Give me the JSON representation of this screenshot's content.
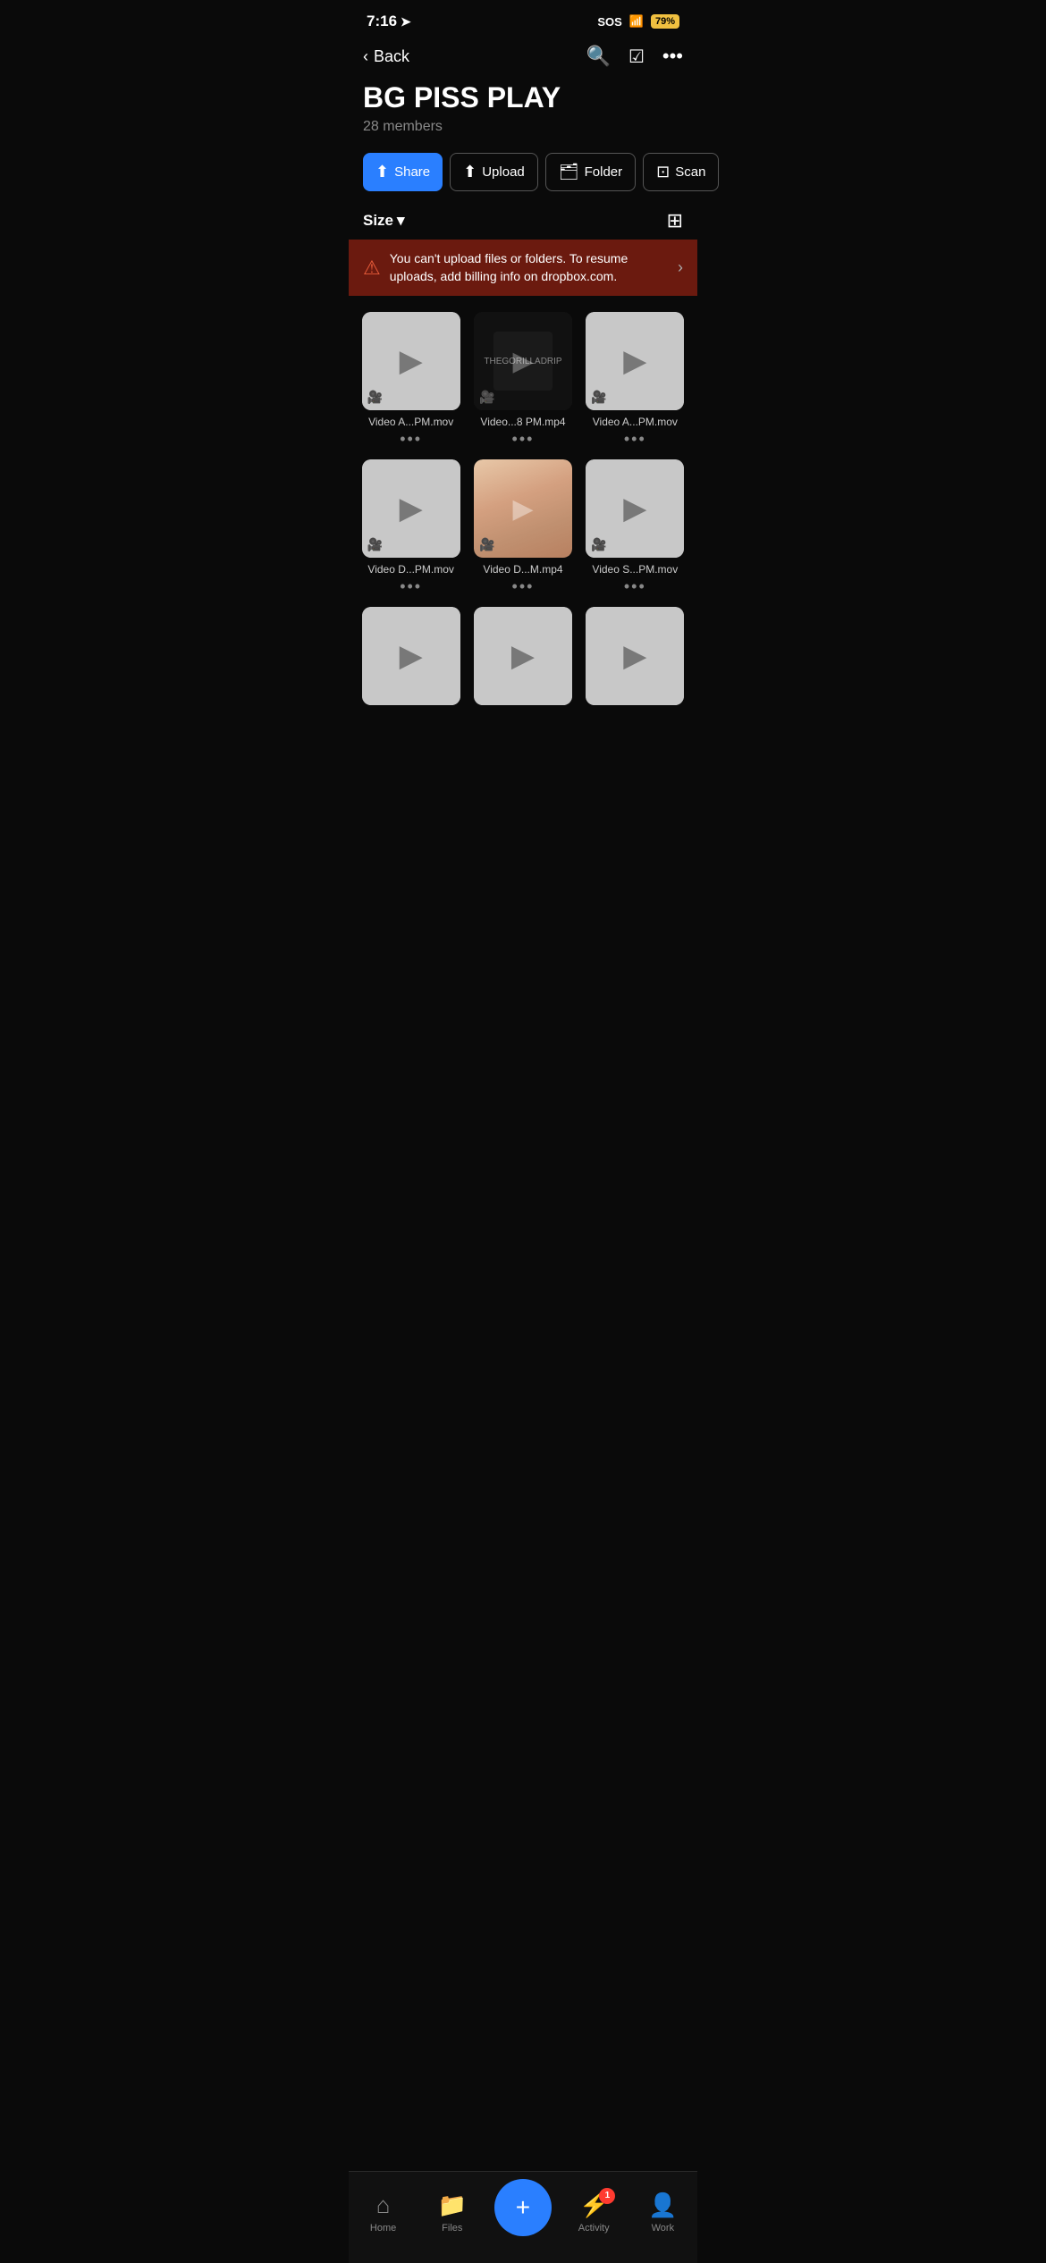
{
  "statusBar": {
    "time": "7:16",
    "sos": "SOS",
    "battery": "79",
    "batteryUnit": "%"
  },
  "header": {
    "backLabel": "Back",
    "searchIcon": "search",
    "checkIcon": "check-square",
    "moreIcon": "ellipsis"
  },
  "folder": {
    "title": "BG PISS PLAY",
    "members": "28 members"
  },
  "actionButtons": [
    {
      "id": "share",
      "icon": "↑",
      "label": "Share",
      "style": "primary"
    },
    {
      "id": "upload",
      "icon": "⬆",
      "label": "Upload",
      "style": "secondary"
    },
    {
      "id": "folder",
      "icon": "📁",
      "label": "Folder",
      "style": "secondary"
    },
    {
      "id": "scan",
      "icon": "⊡",
      "label": "Scan",
      "style": "secondary"
    }
  ],
  "sort": {
    "label": "Size",
    "chevron": "▾"
  },
  "warning": {
    "text": "You can't upload files or folders. To resume uploads, add billing info on dropbox.com."
  },
  "files": [
    {
      "id": 1,
      "name": "Video A...PM.mov",
      "type": "video",
      "preview": "dark"
    },
    {
      "id": 2,
      "name": "Video...8 PM.mp4",
      "type": "video",
      "preview": "dark-preview"
    },
    {
      "id": 3,
      "name": "Video A...PM.mov",
      "type": "video",
      "preview": "dark"
    },
    {
      "id": 4,
      "name": "Video D...PM.mov",
      "type": "video",
      "preview": "dark"
    },
    {
      "id": 5,
      "name": "Video D...M.mp4",
      "type": "video",
      "preview": "skin"
    },
    {
      "id": 6,
      "name": "Video S...PM.mov",
      "type": "video",
      "preview": "dark"
    },
    {
      "id": 7,
      "name": "",
      "type": "video",
      "preview": "dark"
    },
    {
      "id": 8,
      "name": "",
      "type": "video",
      "preview": "dark"
    },
    {
      "id": 9,
      "name": "",
      "type": "video",
      "preview": "dark"
    }
  ],
  "bottomNav": [
    {
      "id": "home",
      "icon": "⌂",
      "label": "Home",
      "active": false
    },
    {
      "id": "files",
      "icon": "📁",
      "label": "Files",
      "active": false
    },
    {
      "id": "add",
      "icon": "+",
      "label": "",
      "active": false
    },
    {
      "id": "activity",
      "icon": "⚡",
      "label": "Activity",
      "active": false,
      "badge": "1"
    },
    {
      "id": "work",
      "icon": "👤",
      "label": "Work",
      "active": false
    }
  ]
}
